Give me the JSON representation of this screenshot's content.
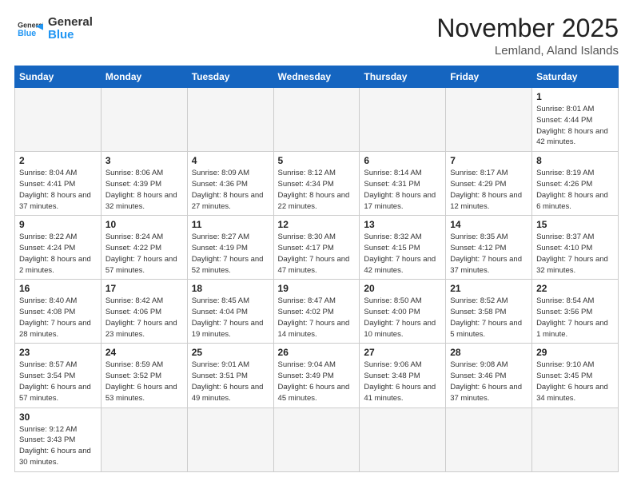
{
  "header": {
    "logo_general": "General",
    "logo_blue": "Blue",
    "month_title": "November 2025",
    "subtitle": "Lemland, Aland Islands"
  },
  "weekdays": [
    "Sunday",
    "Monday",
    "Tuesday",
    "Wednesday",
    "Thursday",
    "Friday",
    "Saturday"
  ],
  "weeks": [
    [
      {
        "day": "",
        "info": ""
      },
      {
        "day": "",
        "info": ""
      },
      {
        "day": "",
        "info": ""
      },
      {
        "day": "",
        "info": ""
      },
      {
        "day": "",
        "info": ""
      },
      {
        "day": "",
        "info": ""
      },
      {
        "day": "1",
        "info": "Sunrise: 8:01 AM\nSunset: 4:44 PM\nDaylight: 8 hours\nand 42 minutes."
      }
    ],
    [
      {
        "day": "2",
        "info": "Sunrise: 8:04 AM\nSunset: 4:41 PM\nDaylight: 8 hours\nand 37 minutes."
      },
      {
        "day": "3",
        "info": "Sunrise: 8:06 AM\nSunset: 4:39 PM\nDaylight: 8 hours\nand 32 minutes."
      },
      {
        "day": "4",
        "info": "Sunrise: 8:09 AM\nSunset: 4:36 PM\nDaylight: 8 hours\nand 27 minutes."
      },
      {
        "day": "5",
        "info": "Sunrise: 8:12 AM\nSunset: 4:34 PM\nDaylight: 8 hours\nand 22 minutes."
      },
      {
        "day": "6",
        "info": "Sunrise: 8:14 AM\nSunset: 4:31 PM\nDaylight: 8 hours\nand 17 minutes."
      },
      {
        "day": "7",
        "info": "Sunrise: 8:17 AM\nSunset: 4:29 PM\nDaylight: 8 hours\nand 12 minutes."
      },
      {
        "day": "8",
        "info": "Sunrise: 8:19 AM\nSunset: 4:26 PM\nDaylight: 8 hours\nand 6 minutes."
      }
    ],
    [
      {
        "day": "9",
        "info": "Sunrise: 8:22 AM\nSunset: 4:24 PM\nDaylight: 8 hours\nand 2 minutes."
      },
      {
        "day": "10",
        "info": "Sunrise: 8:24 AM\nSunset: 4:22 PM\nDaylight: 7 hours\nand 57 minutes."
      },
      {
        "day": "11",
        "info": "Sunrise: 8:27 AM\nSunset: 4:19 PM\nDaylight: 7 hours\nand 52 minutes."
      },
      {
        "day": "12",
        "info": "Sunrise: 8:30 AM\nSunset: 4:17 PM\nDaylight: 7 hours\nand 47 minutes."
      },
      {
        "day": "13",
        "info": "Sunrise: 8:32 AM\nSunset: 4:15 PM\nDaylight: 7 hours\nand 42 minutes."
      },
      {
        "day": "14",
        "info": "Sunrise: 8:35 AM\nSunset: 4:12 PM\nDaylight: 7 hours\nand 37 minutes."
      },
      {
        "day": "15",
        "info": "Sunrise: 8:37 AM\nSunset: 4:10 PM\nDaylight: 7 hours\nand 32 minutes."
      }
    ],
    [
      {
        "day": "16",
        "info": "Sunrise: 8:40 AM\nSunset: 4:08 PM\nDaylight: 7 hours\nand 28 minutes."
      },
      {
        "day": "17",
        "info": "Sunrise: 8:42 AM\nSunset: 4:06 PM\nDaylight: 7 hours\nand 23 minutes."
      },
      {
        "day": "18",
        "info": "Sunrise: 8:45 AM\nSunset: 4:04 PM\nDaylight: 7 hours\nand 19 minutes."
      },
      {
        "day": "19",
        "info": "Sunrise: 8:47 AM\nSunset: 4:02 PM\nDaylight: 7 hours\nand 14 minutes."
      },
      {
        "day": "20",
        "info": "Sunrise: 8:50 AM\nSunset: 4:00 PM\nDaylight: 7 hours\nand 10 minutes."
      },
      {
        "day": "21",
        "info": "Sunrise: 8:52 AM\nSunset: 3:58 PM\nDaylight: 7 hours\nand 5 minutes."
      },
      {
        "day": "22",
        "info": "Sunrise: 8:54 AM\nSunset: 3:56 PM\nDaylight: 7 hours\nand 1 minute."
      }
    ],
    [
      {
        "day": "23",
        "info": "Sunrise: 8:57 AM\nSunset: 3:54 PM\nDaylight: 6 hours\nand 57 minutes."
      },
      {
        "day": "24",
        "info": "Sunrise: 8:59 AM\nSunset: 3:52 PM\nDaylight: 6 hours\nand 53 minutes."
      },
      {
        "day": "25",
        "info": "Sunrise: 9:01 AM\nSunset: 3:51 PM\nDaylight: 6 hours\nand 49 minutes."
      },
      {
        "day": "26",
        "info": "Sunrise: 9:04 AM\nSunset: 3:49 PM\nDaylight: 6 hours\nand 45 minutes."
      },
      {
        "day": "27",
        "info": "Sunrise: 9:06 AM\nSunset: 3:48 PM\nDaylight: 6 hours\nand 41 minutes."
      },
      {
        "day": "28",
        "info": "Sunrise: 9:08 AM\nSunset: 3:46 PM\nDaylight: 6 hours\nand 37 minutes."
      },
      {
        "day": "29",
        "info": "Sunrise: 9:10 AM\nSunset: 3:45 PM\nDaylight: 6 hours\nand 34 minutes."
      }
    ],
    [
      {
        "day": "30",
        "info": "Sunrise: 9:12 AM\nSunset: 3:43 PM\nDaylight: 6 hours\nand 30 minutes."
      },
      {
        "day": "",
        "info": ""
      },
      {
        "day": "",
        "info": ""
      },
      {
        "day": "",
        "info": ""
      },
      {
        "day": "",
        "info": ""
      },
      {
        "day": "",
        "info": ""
      },
      {
        "day": "",
        "info": ""
      }
    ]
  ]
}
